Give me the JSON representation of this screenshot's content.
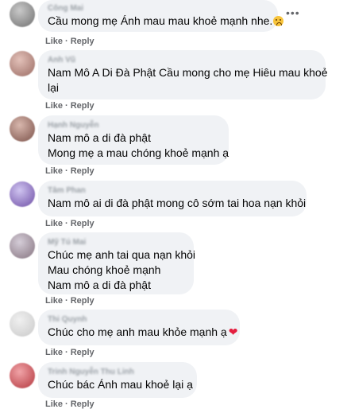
{
  "comments": [
    {
      "author": "Công Mai",
      "lines": [
        "Cầu mong mẹ Ánh mau mau khoẻ mạnh nhe."
      ],
      "emoji": "sad-face-icon",
      "actions": {
        "like": "Like",
        "sep": "·",
        "reply": "Reply"
      }
    },
    {
      "author": "Anh Vũ",
      "lines": [
        "Nam Mô A Di Đà Phật Cầu mong cho mẹ Hiêu mau khoẻ",
        "lại"
      ],
      "actions": {
        "like": "Like",
        "sep": "·",
        "reply": "Reply"
      }
    },
    {
      "author": "Hạnh Nguyễn",
      "lines": [
        "Nam mô a di đà phật",
        "Mong mẹ a mau chóng khoẻ mạnh ạ"
      ],
      "actions": {
        "like": "Like",
        "sep": "·",
        "reply": "Reply"
      }
    },
    {
      "author": "Tâm Phan",
      "lines": [
        "Nam mô ai di đà phật mong cô sớm tai hoa nạn khỏi"
      ],
      "actions": {
        "like": "Like",
        "sep": "·",
        "reply": "Reply"
      }
    },
    {
      "author": "Mỹ Tú Mai",
      "lines": [
        "Chúc mẹ anh tai qua nạn khỏi",
        "Mau chóng khoẻ mạnh",
        "Nam mô a di đà phật"
      ],
      "actions": {
        "like": "Like",
        "sep": "·",
        "reply": "Reply"
      }
    },
    {
      "author": "Thi Quynh",
      "lines": [
        "Chúc cho mẹ anh mau khỏe mạnh ạ"
      ],
      "emoji": "heart-icon",
      "actions": {
        "like": "Like",
        "sep": "·",
        "reply": "Reply"
      }
    },
    {
      "author": "Trinh Nguyễn Thu Linh",
      "lines": [
        "Chúc bác Ánh mau khoẻ lại ạ"
      ],
      "actions": {
        "like": "Like",
        "sep": "·",
        "reply": "Reply"
      }
    }
  ],
  "more_icon": "more-options-icon",
  "heart_glyph": "❤"
}
